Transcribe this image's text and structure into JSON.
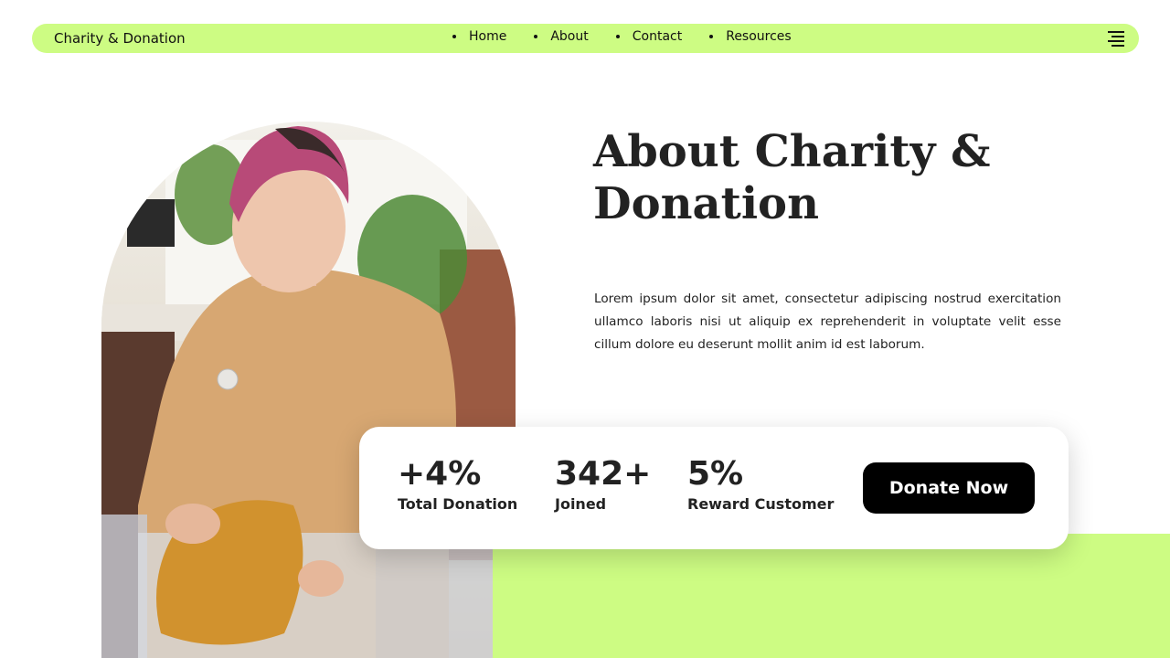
{
  "nav": {
    "brand": "Charity & Donation",
    "items": [
      {
        "label": "Home"
      },
      {
        "label": "About"
      },
      {
        "label": "Contact"
      },
      {
        "label": "Resources"
      }
    ],
    "menu_icon": "hamburger-menu-icon"
  },
  "about": {
    "title": "About Charity & Donation",
    "description": "Lorem ipsum dolor sit amet, consectetur adipiscing nostrud exercitation ullamco laboris nisi ut aliquip ex reprehenderit in voluptate velit esse cillum dolore eu deserunt mollit anim id est laborum."
  },
  "stats": [
    {
      "value": "+4%",
      "label": "Total Donation"
    },
    {
      "value": "342+",
      "label": "Joined"
    },
    {
      "value": "5%",
      "label": "Reward Customer"
    }
  ],
  "cta": {
    "label": "Donate Now"
  },
  "colors": {
    "accent": "#cdfc83",
    "button": "#000000",
    "text": "#222222"
  }
}
